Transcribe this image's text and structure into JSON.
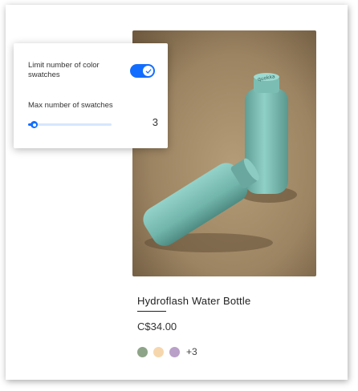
{
  "settings": {
    "limit_label": "Limit number of color swatches",
    "limit_enabled": true,
    "max_label": "Max number of swatches",
    "max_value": "3",
    "slider": {
      "min": 1,
      "max": 30,
      "value": 3
    }
  },
  "product": {
    "title": "Hydroflash Water Bottle",
    "price": "C$34.00",
    "swatches": [
      {
        "name": "sage",
        "color": "#8ea488"
      },
      {
        "name": "peach",
        "color": "#f6d7ad"
      },
      {
        "name": "lavender",
        "color": "#b9a0c8"
      }
    ],
    "more_swatches": "+3",
    "bottle_brand": "quokka"
  },
  "colors": {
    "accent": "#116dff",
    "image_background": "#a08765",
    "bottle": "#7ec2b8"
  }
}
